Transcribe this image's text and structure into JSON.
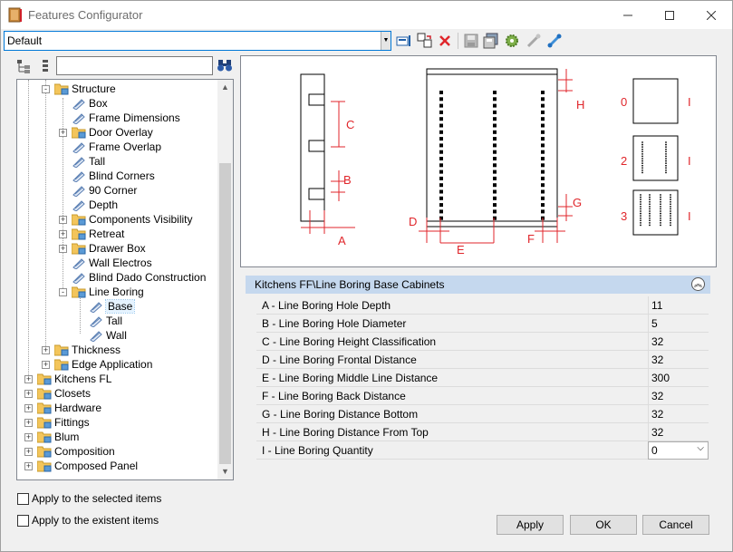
{
  "window": {
    "title": "Features Configurator"
  },
  "toolbar": {
    "profile_value": "Default"
  },
  "search": {
    "value": ""
  },
  "tree": {
    "nodes": [
      "Structure",
      "Box",
      "Frame Dimensions",
      "Door Overlay",
      "Frame Overlap",
      "Tall",
      "Blind Corners",
      "90 Corner",
      "Depth",
      "Components Visibility",
      "Retreat",
      "Drawer Box",
      "Wall Electros",
      "Blind Dado Construction",
      "Line Boring",
      "Base",
      "Tall",
      "Wall",
      "Thickness",
      "Edge Application",
      "Kitchens FL",
      "Closets",
      "Hardware",
      "Fittings",
      "Blum",
      "Composition",
      "Composed Panel"
    ]
  },
  "options": {
    "apply_selected": "Apply to the selected items",
    "apply_existent": "Apply to the existent items"
  },
  "preview": {
    "dims": [
      "C",
      "B",
      "A",
      "H",
      "G",
      "D",
      "E",
      "F"
    ],
    "quantities": [
      "0",
      "2",
      "3"
    ],
    "quantity_marks": [
      "I",
      "I",
      "I"
    ]
  },
  "grid": {
    "header": "Kitchens FF\\Line Boring Base Cabinets",
    "rows": [
      {
        "name": "A - Line Boring Hole Depth",
        "value": "11"
      },
      {
        "name": "B - Line Boring Hole Diameter",
        "value": "5"
      },
      {
        "name": "C - Line Boring Height Classification",
        "value": "32"
      },
      {
        "name": "D - Line Boring Frontal Distance",
        "value": "32"
      },
      {
        "name": "E - Line Boring Middle Line Distance",
        "value": "300"
      },
      {
        "name": "F - Line Boring Back Distance",
        "value": "32"
      },
      {
        "name": "G - Line Boring Distance Bottom",
        "value": "32"
      },
      {
        "name": "H - Line Boring Distance From Top",
        "value": "32"
      },
      {
        "name": "I - Line Boring Quantity",
        "value": "0"
      }
    ]
  },
  "buttons": {
    "apply": "Apply",
    "ok": "OK",
    "cancel": "Cancel"
  },
  "colors": {
    "dimension": "#e0262b",
    "header": "#c5d8ee",
    "folder": "#f3c55b"
  }
}
